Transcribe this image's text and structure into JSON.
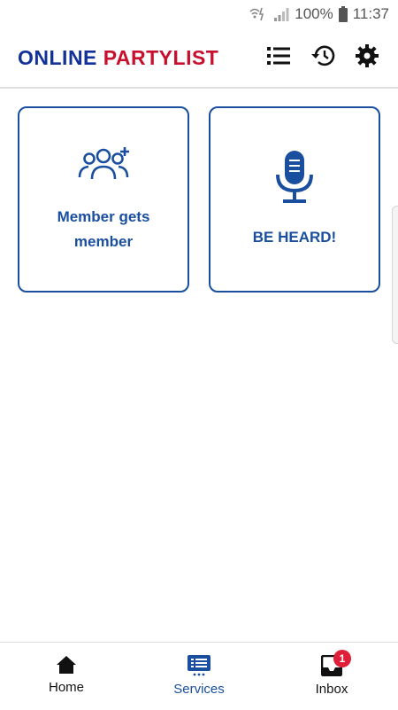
{
  "status_bar": {
    "battery": "100%",
    "time": "11:37",
    "icons": [
      "wifi-calling-icon",
      "signal-icon",
      "battery-icon"
    ]
  },
  "header": {
    "title_part1": "ONLINE",
    "title_part2": "PARTYLIST",
    "actions": [
      "list-icon",
      "history-icon",
      "settings-icon"
    ]
  },
  "tiles": [
    {
      "label": "Member gets member",
      "icon": "add-group-icon"
    },
    {
      "label": "BE HEARD!",
      "icon": "microphone-icon"
    }
  ],
  "bottom_nav": [
    {
      "label": "Home",
      "icon": "home-icon",
      "active": false
    },
    {
      "label": "Services",
      "icon": "services-icon",
      "active": true
    },
    {
      "label": "Inbox",
      "icon": "inbox-icon",
      "active": false,
      "badge": "1"
    }
  ],
  "colors": {
    "brand_blue": "#12329a",
    "brand_red": "#c8102e",
    "accent_blue": "#1a4fa0",
    "badge_red": "#e0203a"
  }
}
